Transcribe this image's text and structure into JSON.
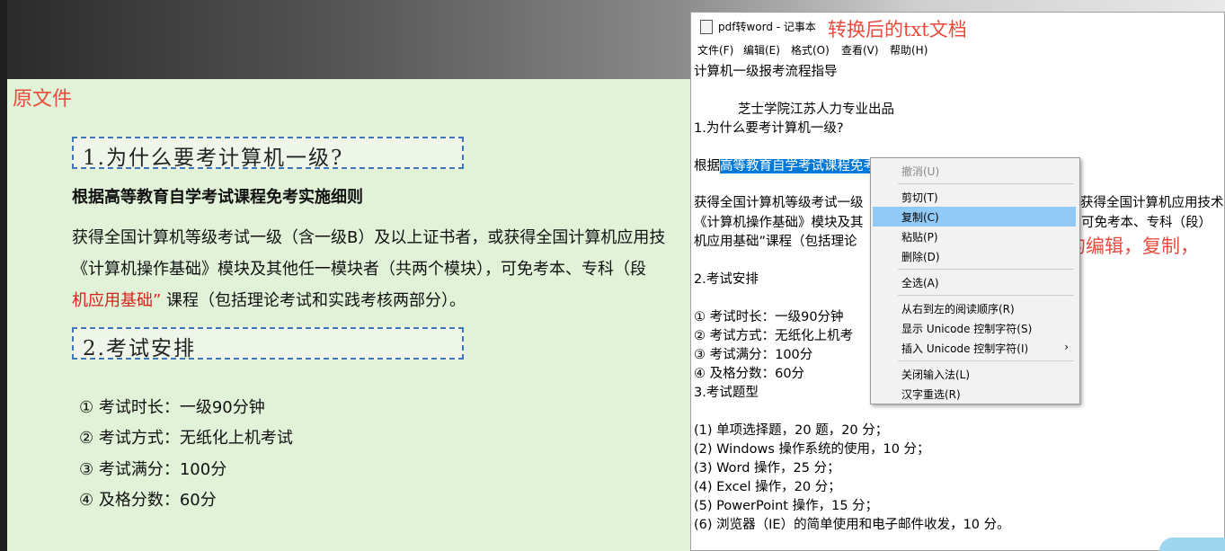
{
  "original": {
    "label": "原文件",
    "heading1": "1.为什么要考计算机一级?",
    "bold_line": "根据高等教育自学考试课程免考实施细则",
    "para1": "获得全国计算机等级考试一级（含一级B）及以上证书者，或获得全国计算机应用技",
    "para2": "《计算机操作基础》模块及其他任一模块者（共两个模块），可免考本、专科（段",
    "para3_red": "机应用基础”",
    "para3_rest": " 课程（包括理论考试和实践考核两部分）。",
    "heading2": "2.考试安排",
    "list": [
      "①  考试时长：一级90分钟",
      "②  考试方式：无纸化上机考试",
      "③  考试满分：100分",
      "④  及格分数：60分"
    ]
  },
  "notepad": {
    "title": "pdf转word - 记事本",
    "annotation": "转换后的txt文档",
    "menu": [
      "文件(F)",
      "编辑(E)",
      "格式(O)",
      "查看(V)",
      "帮助(H)"
    ],
    "lines": {
      "l1": "计算机一级报考流程指导",
      "l2": "芝士学院江苏人力专业出品",
      "l3": " 1.为什么要考计算机一级?",
      "l4_pre": "根据",
      "l4_sel": "高等教育自学考试课程免考实施细则",
      "l5a": "获得全国计算机等级考试一级",
      "l5b": "获得全国计算机应用技术",
      "l6a": "《计算机操作基础》模块及其",
      "l6b": "可免考本、专科（段）",
      "l7a": "机应用基础”课程（包括理论",
      "l8": " 2.考试安排",
      "l9": " ①  考试时长：一级90分钟",
      "l10": " ②  考试方式：无纸化上机考",
      "l11": " ③  考试满分：100分",
      "l12": " ④  及格分数：60分",
      "l13": " 3.考试题型",
      "q1": "  (1) 单项选择题，20 题，20 分；",
      "q2": "  (2) Windows 操作系统的使用，10 分；",
      "q3": "  (3) Word 操作，25 分；",
      "q4": "  (4) Excel 操作，20 分；",
      "q5": "  (5) PowerPoint 操作，15 分；",
      "q6": "  (6) 浏览器（IE）的简单使用和电子邮件收发，10 分。"
    },
    "annotation2": "可以进行任意的编辑，复制，粘贴之类"
  },
  "context_menu": {
    "undo": "撤消(U)",
    "cut": "剪切(T)",
    "copy": "复制(C)",
    "paste": "粘贴(P)",
    "delete": "删除(D)",
    "select_all": "全选(A)",
    "rtl": "从右到左的阅读顺序(R)",
    "show_unicode": "显示 Unicode 控制字符(S)",
    "insert_unicode": "插入 Unicode 控制字符(I)",
    "arrow": "›",
    "close_ime": "关闭输入法(L)",
    "reconvert": "汉字重选(R)"
  }
}
